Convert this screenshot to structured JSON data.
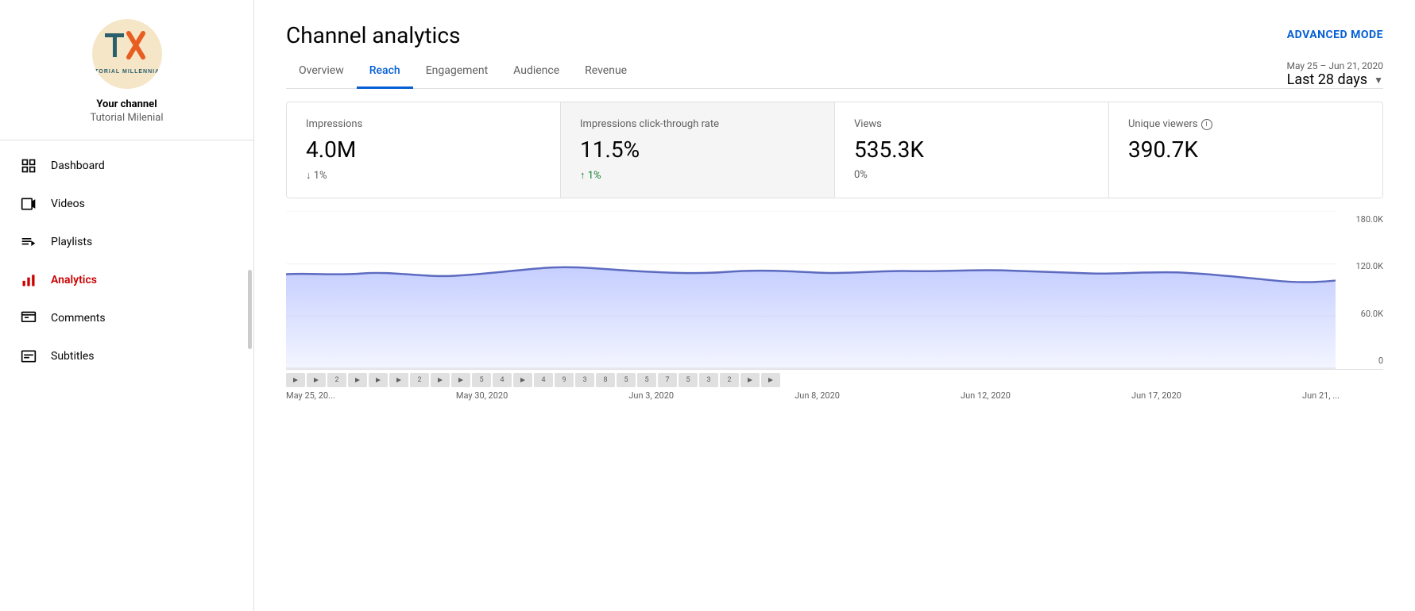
{
  "channel": {
    "label": "Your channel",
    "name": "Tutorial Milenial"
  },
  "nav": {
    "items": [
      {
        "id": "dashboard",
        "label": "Dashboard",
        "icon": "grid"
      },
      {
        "id": "videos",
        "label": "Videos",
        "icon": "video"
      },
      {
        "id": "playlists",
        "label": "Playlists",
        "icon": "list"
      },
      {
        "id": "analytics",
        "label": "Analytics",
        "icon": "bar-chart",
        "active": true
      },
      {
        "id": "comments",
        "label": "Comments",
        "icon": "comment"
      },
      {
        "id": "subtitles",
        "label": "Subtitles",
        "icon": "subtitles"
      }
    ]
  },
  "header": {
    "title": "Channel analytics",
    "advanced_mode": "ADVANCED MODE"
  },
  "date": {
    "range": "May 25 – Jun 21, 2020",
    "period": "Last 28 days"
  },
  "tabs": [
    {
      "id": "overview",
      "label": "Overview"
    },
    {
      "id": "reach",
      "label": "Reach",
      "active": true
    },
    {
      "id": "engagement",
      "label": "Engagement"
    },
    {
      "id": "audience",
      "label": "Audience"
    },
    {
      "id": "revenue",
      "label": "Revenue"
    }
  ],
  "metrics": [
    {
      "id": "impressions",
      "label": "Impressions",
      "value": "4.0M",
      "change": "↓ 1%",
      "change_type": "down",
      "highlighted": false
    },
    {
      "id": "ctr",
      "label": "Impressions click-through rate",
      "value": "11.5%",
      "change": "↑ 1%",
      "change_type": "up",
      "highlighted": true
    },
    {
      "id": "views",
      "label": "Views",
      "value": "535.3K",
      "change": "0%",
      "change_type": "neutral",
      "highlighted": false
    },
    {
      "id": "unique_viewers",
      "label": "Unique viewers",
      "value": "390.7K",
      "change": "",
      "change_type": "neutral",
      "highlighted": false,
      "has_info": true
    }
  ],
  "chart": {
    "y_labels": [
      "180.0K",
      "120.0K",
      "60.0K",
      "0"
    ],
    "x_labels": [
      "May 25, 20...",
      "May 30, 2020",
      "Jun 3, 2020",
      "Jun 8, 2020",
      "Jun 12, 2020",
      "Jun 17, 2020",
      "Jun 21, ..."
    ]
  },
  "video_markers": [
    "▶",
    "▶",
    "2",
    "▶",
    "▶",
    "▶",
    "2",
    "▶",
    "▶",
    "5",
    "4",
    "▶",
    "4",
    "9",
    "3",
    "8",
    "5",
    "5",
    "7",
    "5",
    "3",
    "2",
    "▶",
    "▶"
  ]
}
